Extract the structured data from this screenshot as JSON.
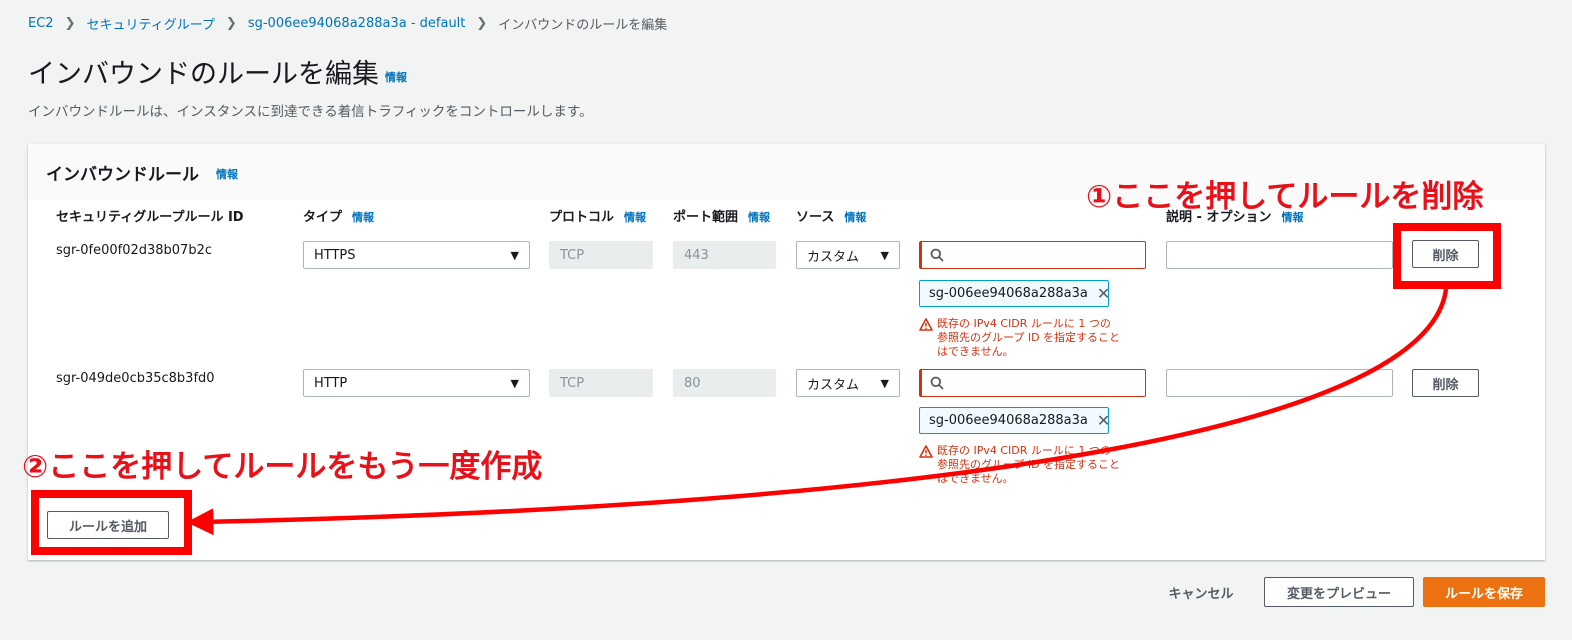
{
  "breadcrumb": [
    {
      "label": "EC2"
    },
    {
      "label": "セキュリティグループ"
    },
    {
      "label": "sg-006ee94068a288a3a - default"
    },
    {
      "label": "インバウンドのルールを編集"
    }
  ],
  "info_label": "情報",
  "page": {
    "title": "インバウンドのルールを編集",
    "description": "インバウンドルールは、インスタンスに到達できる着信トラフィックをコントロールします。"
  },
  "panel": {
    "title": "インバウンドルール",
    "columns": {
      "rule_id": "セキュリティグループルール ID",
      "type": "タイプ",
      "protocol": "プロトコル",
      "port": "ポート範囲",
      "source": "ソース",
      "description": "説明 - オプション"
    },
    "rules": [
      {
        "id": "sgr-0fe00f02d38b07b2c",
        "type": "HTTPS",
        "protocol": "TCP",
        "port": "443",
        "source": "カスタム",
        "token": "sg-006ee94068a288a3a",
        "error": "既存の IPv4 CIDR ルールに 1 つの 参照先のグループ ID を指定することはできません。",
        "delete_label": "削除"
      },
      {
        "id": "sgr-049de0cb35c8b3fd0",
        "type": "HTTP",
        "protocol": "TCP",
        "port": "80",
        "source": "カスタム",
        "token": "sg-006ee94068a288a3a",
        "error": "既存の IPv4 CIDR ルールに 1 つの 参照先のグループ ID を指定することはできません。",
        "delete_label": "削除"
      }
    ],
    "add_rule_label": "ルールを追加"
  },
  "footer": {
    "cancel_label": "キャンセル",
    "preview_label": "変更をプレビュー",
    "save_label": "ルールを保存"
  },
  "annotations": {
    "step1": "①ここを押してルールを削除",
    "step2": "②ここを押してルールをもう一度作成",
    "color": "#e8111a"
  },
  "icons": {
    "breadcrumb_separator": "chevron-right-icon",
    "search": "search-icon",
    "dropdown": "caret-down-icon",
    "remove_token": "close-icon",
    "error": "warning-icon"
  },
  "colors": {
    "link": "#0073bb",
    "error": "#d13212",
    "primary": "#ec7211",
    "annotation": "#ff0000"
  }
}
